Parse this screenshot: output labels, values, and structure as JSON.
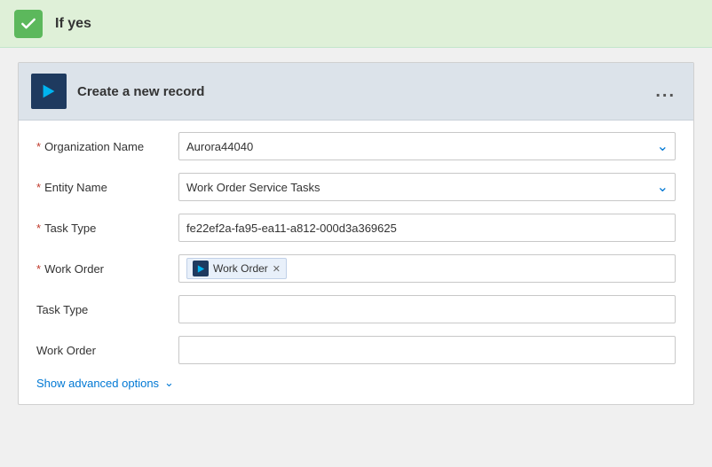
{
  "header": {
    "title": "If yes",
    "check_icon": "checkmark-icon"
  },
  "card": {
    "title": "Create a new record",
    "menu_label": "...",
    "icon": "dynamics-icon"
  },
  "form": {
    "fields": [
      {
        "id": "org-name",
        "label": "Organization Name",
        "required": true,
        "type": "dropdown",
        "value": "Aurora44040"
      },
      {
        "id": "entity-name",
        "label": "Entity Name",
        "required": true,
        "type": "dropdown",
        "value": "Work Order Service Tasks"
      },
      {
        "id": "task-type-required",
        "label": "Task Type",
        "required": true,
        "type": "text",
        "value": "fe22ef2a-fa95-ea11-a812-000d3a369625"
      },
      {
        "id": "work-order-required",
        "label": "Work Order",
        "required": true,
        "type": "tag",
        "tag_label": "Work Order"
      },
      {
        "id": "task-type-optional",
        "label": "Task Type",
        "required": false,
        "type": "text",
        "value": ""
      },
      {
        "id": "work-order-optional",
        "label": "Work Order",
        "required": false,
        "type": "text",
        "value": ""
      }
    ],
    "advanced_options_label": "Show advanced options"
  }
}
